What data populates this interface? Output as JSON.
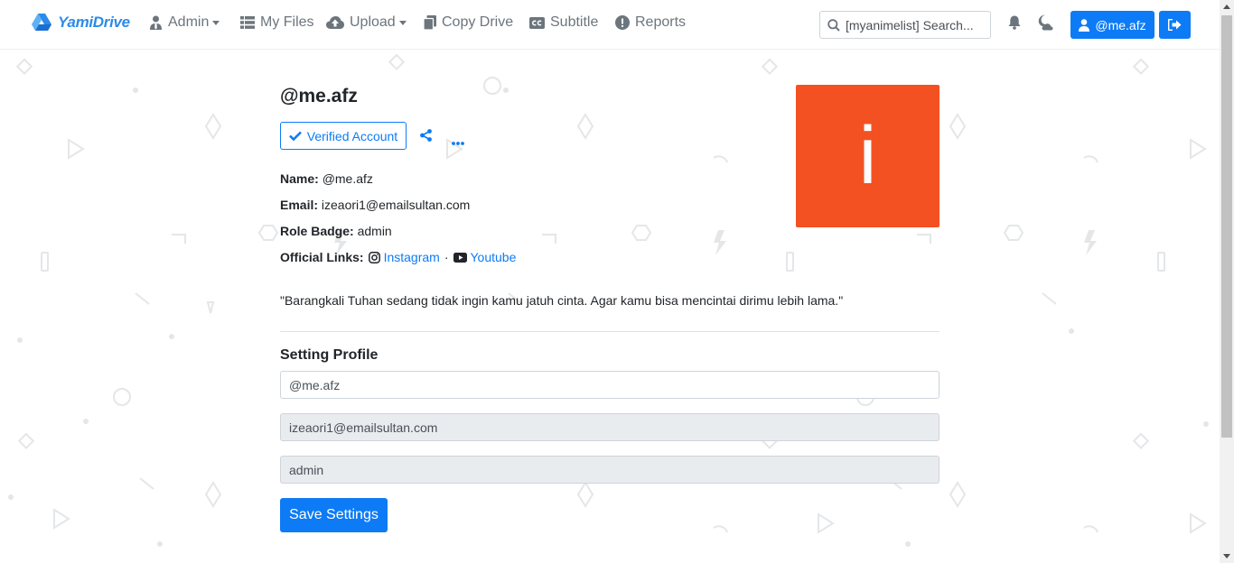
{
  "brand": {
    "name": "YamiDrive"
  },
  "nav": {
    "items": [
      {
        "label": "Admin",
        "icon": "user-tie-icon",
        "dropdown": true
      },
      {
        "label": "My Files",
        "icon": "list-icon",
        "dropdown": false
      },
      {
        "label": "Upload",
        "icon": "cloud-upload-icon",
        "dropdown": true
      },
      {
        "label": "Copy Drive",
        "icon": "copy-icon",
        "dropdown": false
      },
      {
        "label": "Subtitle",
        "icon": "closed-captions-icon",
        "dropdown": false
      },
      {
        "label": "Reports",
        "icon": "exclamation-circle-icon",
        "dropdown": false
      }
    ],
    "search_placeholder": "[myanimelist] Search...",
    "user_button": "@me.afz"
  },
  "profile": {
    "username": "@me.afz",
    "verified_label": "Verified Account",
    "name_label": "Name:",
    "name_value": "@me.afz",
    "email_label": "Email:",
    "email_value": "izeaori1@emailsultan.com",
    "role_label": "Role Badge:",
    "role_value": "admin",
    "links_label": "Official Links:",
    "link_instagram": "Instagram",
    "link_separator": "·",
    "link_youtube": "Youtube",
    "quote": "\"Barangkali Tuhan sedang tidak ingin kamu jatuh cinta. Agar kamu bisa mencintai dirimu lebih lama.\"",
    "avatar_letter": "i"
  },
  "settings": {
    "title": "Setting Profile",
    "username_value": "@me.afz",
    "email_value": "izeaori1@emailsultan.com",
    "role_value": "admin",
    "save_label": "Save Settings"
  },
  "colors": {
    "primary": "#0d7bf5",
    "avatar_bg": "#f45122",
    "nav_text": "#6c757d"
  }
}
